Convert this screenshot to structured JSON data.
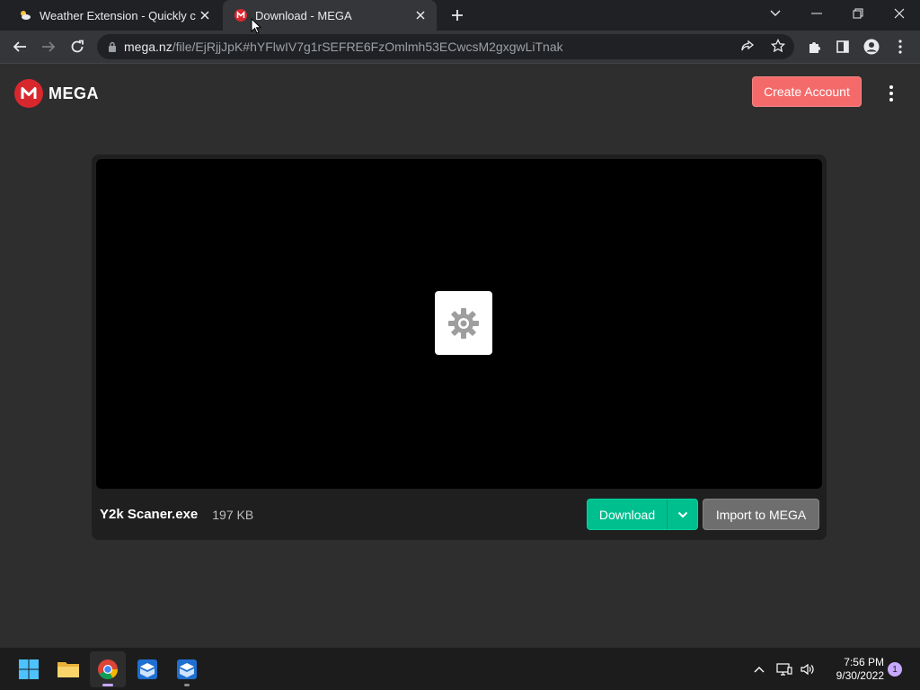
{
  "browser": {
    "tabs": [
      {
        "title": "Weather Extension - Quickly chec",
        "icon": "weather-icon"
      },
      {
        "title": "Download - MEGA",
        "icon": "mega-icon"
      }
    ],
    "address": {
      "host": "mega.nz",
      "path": "/file/EjRjjJpK#hYFlwIV7g1rSEFRE6FzOmlmh53ECwcsM2gxgwLiTnak"
    }
  },
  "site": {
    "logo_letter": "M",
    "logo_text": "MEGA",
    "create_account_label": "Create Account"
  },
  "file": {
    "name": "Y2k Scaner.exe",
    "size": "197 KB",
    "download_label": "Download",
    "import_label": "Import to MEGA",
    "preview_icon": "gear-icon"
  },
  "taskbar": {
    "time": "7:56 PM",
    "date": "9/30/2022",
    "notification_count": "1"
  },
  "colors": {
    "brand": "#d9272e",
    "create_account": "#f46a6a",
    "download": "#00bf8e",
    "import": "#6e6e6e"
  }
}
